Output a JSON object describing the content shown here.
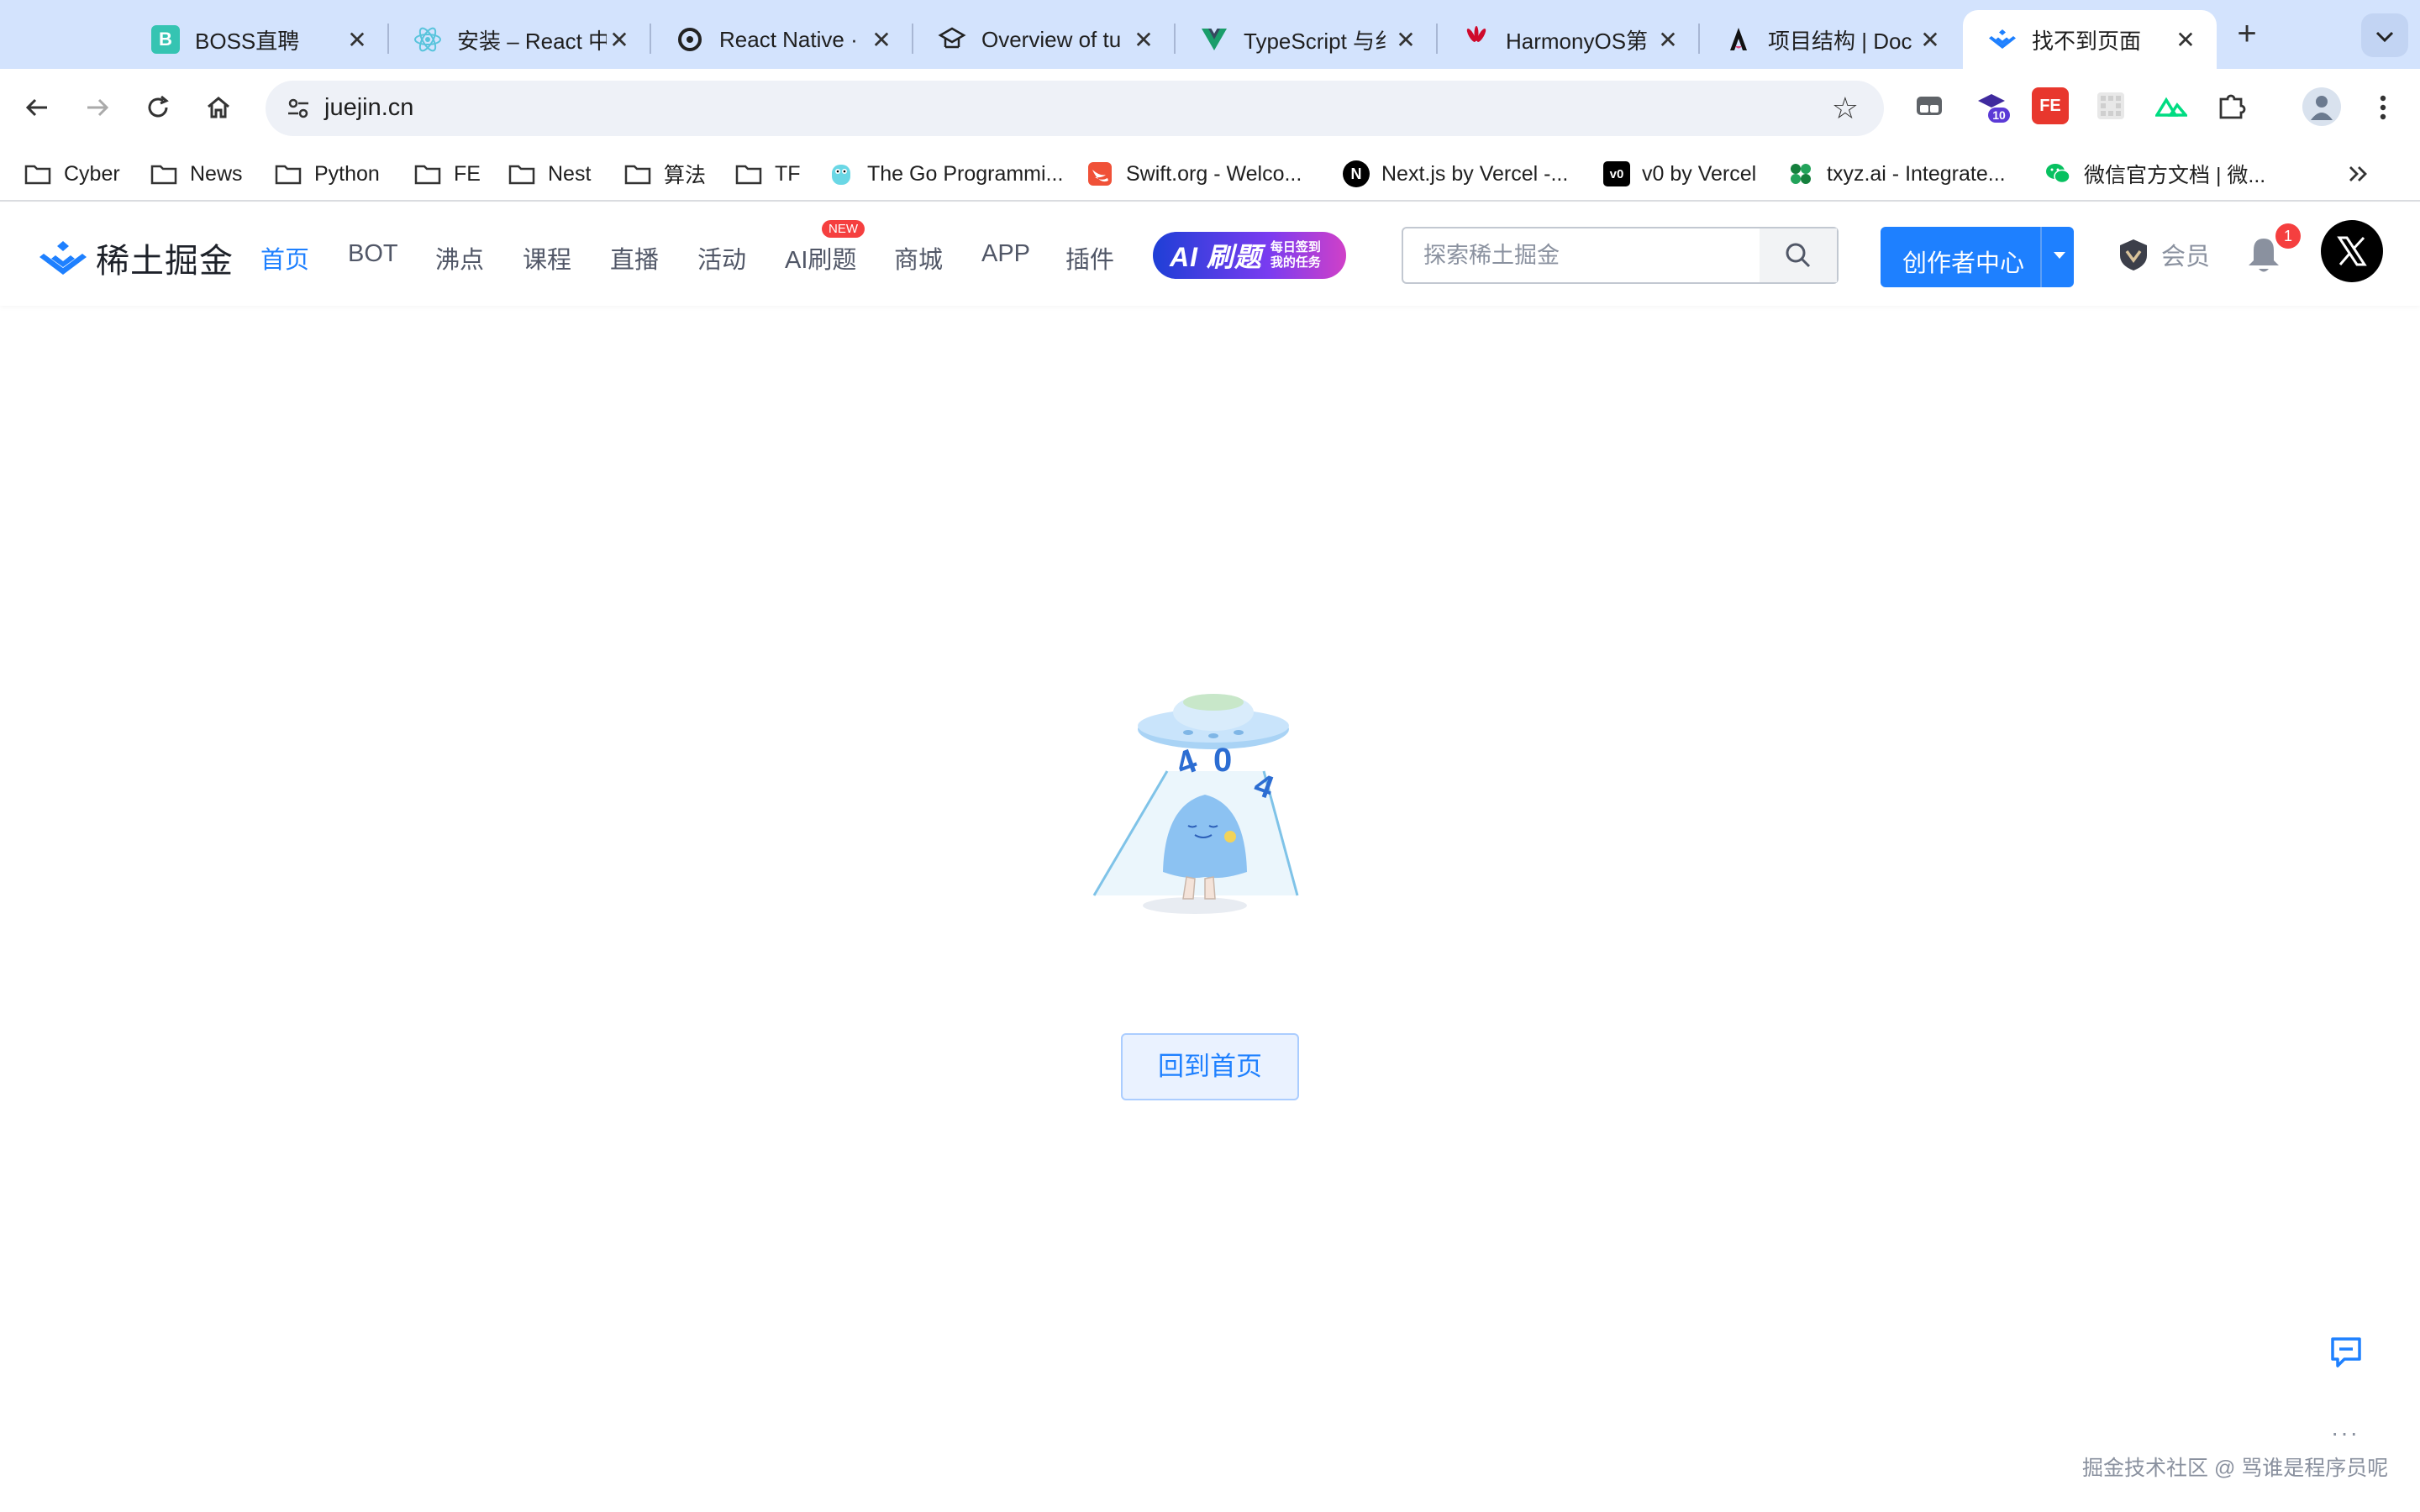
{
  "browser": {
    "tabs": [
      {
        "title": "BOSS直聘",
        "favicon": "boss-icon",
        "color": "#35c4b2"
      },
      {
        "title": "安装 – React 中",
        "favicon": "react-icon",
        "color": "#58c4dc"
      },
      {
        "title": "React Native ·",
        "favicon": "react-native-icon",
        "color": "#222222"
      },
      {
        "title": "Overview of tu",
        "favicon": "graduation-cap-icon",
        "color": "#222222"
      },
      {
        "title": "TypeScript 与纟",
        "favicon": "vue-icon",
        "color": "#1a9d6a"
      },
      {
        "title": "HarmonyOS第",
        "favicon": "huawei-icon",
        "color": "#cf0a2c"
      },
      {
        "title": "项目结构 | Doc",
        "favicon": "astro-icon",
        "color": "#111111"
      },
      {
        "title": "找不到页面",
        "favicon": "juejin-icon",
        "color": "#1e80ff"
      }
    ],
    "active_tab_index": 7,
    "address": "juejin.cn",
    "extensions": [
      {
        "name": "tab-manager-icon",
        "badge": ""
      },
      {
        "name": "graduation-icon",
        "badge": "10"
      },
      {
        "name": "fe-icon",
        "badge": ""
      },
      {
        "name": "grid-icon",
        "badge": ""
      },
      {
        "name": "nuxt-icon",
        "badge": ""
      },
      {
        "name": "puzzle-icon",
        "badge": ""
      }
    ],
    "bookmarks": [
      {
        "label": "Cyber",
        "icon": "folder-icon"
      },
      {
        "label": "News",
        "icon": "folder-icon"
      },
      {
        "label": "Python",
        "icon": "folder-icon"
      },
      {
        "label": "FE",
        "icon": "folder-icon"
      },
      {
        "label": "Nest",
        "icon": "folder-icon"
      },
      {
        "label": "算法",
        "icon": "folder-icon"
      },
      {
        "label": "TF",
        "icon": "folder-icon"
      },
      {
        "label": "The Go Programmi...",
        "icon": "gopher-icon"
      },
      {
        "label": "Swift.org - Welco...",
        "icon": "swift-icon"
      },
      {
        "label": "Next.js by Vercel -...",
        "icon": "nextjs-icon"
      },
      {
        "label": "v0 by Vercel",
        "icon": "v0-icon"
      },
      {
        "label": "txyz.ai - Integrate...",
        "icon": "txyz-icon"
      },
      {
        "label": "微信官方文档 | 微...",
        "icon": "wechat-icon"
      }
    ]
  },
  "site": {
    "brand": "稀土掘金",
    "nav": [
      {
        "label": "首页",
        "active": true
      },
      {
        "label": "BOT",
        "active": false
      },
      {
        "label": "沸点",
        "active": false
      },
      {
        "label": "课程",
        "active": false
      },
      {
        "label": "直播",
        "active": false
      },
      {
        "label": "活动",
        "active": false
      },
      {
        "label": "AI刷题",
        "active": false
      },
      {
        "label": "商城",
        "active": false
      },
      {
        "label": "APP",
        "active": false
      },
      {
        "label": "插件",
        "active": false
      }
    ],
    "new_badge": "NEW",
    "ai_banner": {
      "title": "AI 刷题",
      "line1": "每日签到",
      "line2": "我的任务"
    },
    "search_placeholder": "探索稀土掘金",
    "creator_button": "创作者中心",
    "member_label": "会员",
    "notification_count": "1",
    "accent_color": "#1e80ff"
  },
  "error_page": {
    "illustration_text": "404",
    "home_button": "回到首页"
  },
  "footer": {
    "more": "···",
    "watermark": "掘金技术社区 @ 骂谁是程序员呢"
  }
}
